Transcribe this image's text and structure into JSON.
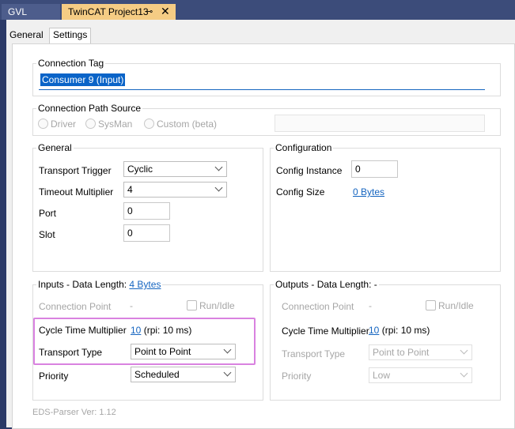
{
  "tabs": [
    {
      "label": "GVL"
    },
    {
      "label": "TwinCAT Project13",
      "pin": "⊸",
      "close": "✕"
    }
  ],
  "subtabs": [
    "General",
    "Settings"
  ],
  "connection_tag": {
    "legend": "Connection Tag",
    "value": "Consumer 9 (Input)"
  },
  "connection_path": {
    "legend": "Connection Path Source",
    "options": [
      "Driver",
      "SysMan",
      "Custom (beta)"
    ]
  },
  "general": {
    "legend": "General",
    "transport_trigger": {
      "label": "Transport Trigger",
      "value": "Cyclic"
    },
    "timeout_multiplier": {
      "label": "Timeout Multiplier",
      "value": "4"
    },
    "port": {
      "label": "Port",
      "value": "0"
    },
    "slot": {
      "label": "Slot",
      "value": "0"
    }
  },
  "configuration": {
    "legend": "Configuration",
    "config_instance": {
      "label": "Config Instance",
      "value": "0"
    },
    "config_size": {
      "label": "Config Size",
      "value": "0 Bytes"
    }
  },
  "inputs": {
    "legend_prefix": "Inputs - Data Length:",
    "legend_link": "4 Bytes",
    "connection_point": {
      "label": "Connection Point",
      "value": "-"
    },
    "run_idle": "Run/Idle",
    "cycle_time": {
      "label": "Cycle Time Multiplier",
      "link": "10",
      "suffix": "(rpi: 10 ms)"
    },
    "transport_type": {
      "label": "Transport Type",
      "value": "Point to Point"
    },
    "priority": {
      "label": "Priority",
      "value": "Scheduled"
    }
  },
  "outputs": {
    "legend": "Outputs - Data Length: -",
    "connection_point": {
      "label": "Connection Point",
      "value": "-"
    },
    "run_idle": "Run/Idle",
    "cycle_time": {
      "label": "Cycle Time Multiplier",
      "link": "10",
      "suffix": "(rpi: 10 ms)"
    },
    "transport_type": {
      "label": "Transport Type",
      "value": "Point to Point"
    },
    "priority": {
      "label": "Priority",
      "value": "Low"
    }
  },
  "footer": {
    "eds_version": "EDS-Parser Ver: 1.12"
  },
  "colors": {
    "accent_tab": "#f5cc84",
    "highlight": "#d982e0",
    "link": "#1565c0"
  }
}
